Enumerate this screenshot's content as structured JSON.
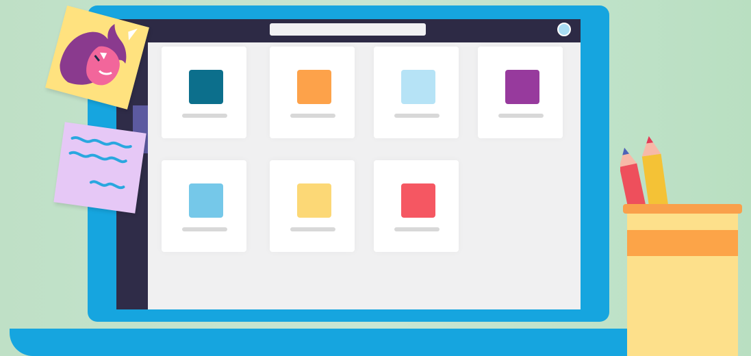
{
  "illustration": {
    "laptop_color": "#16a5df",
    "screen": {
      "app_cards": [
        {
          "color": "#0c6f8c",
          "icon": "app-tile-dark-teal"
        },
        {
          "color": "#fda24a",
          "icon": "app-tile-orange"
        },
        {
          "color": "#b6e3f6",
          "icon": "app-tile-light-blue"
        },
        {
          "color": "#973a9d",
          "icon": "app-tile-purple"
        },
        {
          "color": "#75c8e9",
          "icon": "app-tile-sky-blue"
        },
        {
          "color": "#fcd876",
          "icon": "app-tile-yellow"
        },
        {
          "color": "#f55762",
          "icon": "app-tile-red"
        }
      ]
    },
    "sticky_notes": [
      {
        "color": "#ffe27f",
        "icon": "unicorn-icon"
      },
      {
        "color": "#e6c8f6",
        "icon": "scribble-lines-icon"
      }
    ],
    "pencil_cup": {
      "color": "#fde08b",
      "band_color": "#fca448"
    }
  }
}
